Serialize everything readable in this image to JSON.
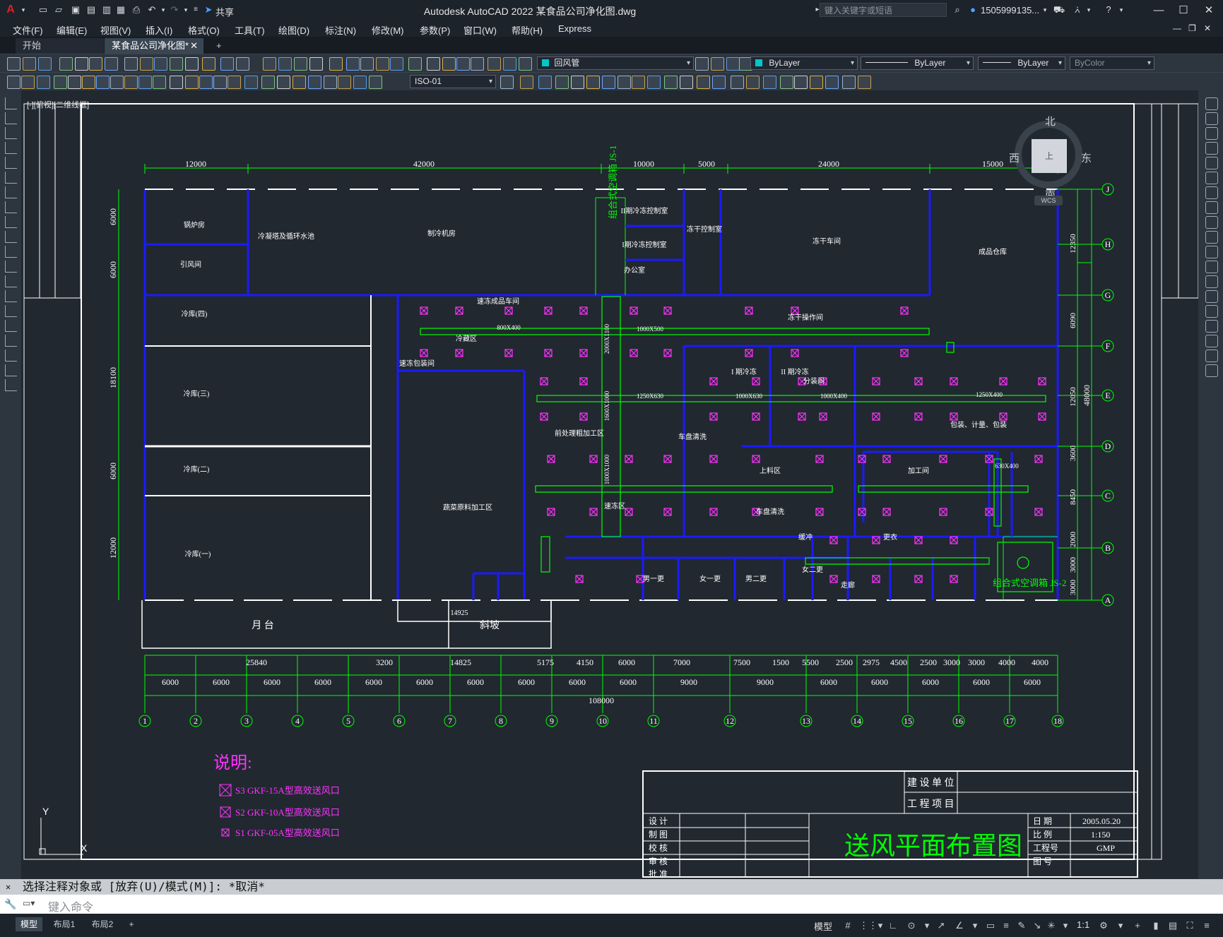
{
  "titlebar": {
    "app_title": "Autodesk AutoCAD 2022    某食品公司净化图.dwg",
    "share_label": "共享",
    "search_placeholder": "键入关键字或短语",
    "user": "1505999135...",
    "minimize": "—",
    "restore": "☐",
    "close": "✕"
  },
  "menu": [
    "文件(F)",
    "编辑(E)",
    "视图(V)",
    "插入(I)",
    "格式(O)",
    "工具(T)",
    "绘图(D)",
    "标注(N)",
    "修改(M)",
    "参数(P)",
    "窗口(W)",
    "帮助(H)",
    "Express"
  ],
  "tabs": {
    "start": "开始",
    "active": "某食品公司净化图*",
    "close": "✕",
    "add": "+"
  },
  "toolbar": {
    "layer_current": "回风管",
    "color": "ByLayer",
    "linetype": "ByLayer",
    "lineweight": "ByLayer",
    "plotstyle": "ByColor",
    "dimstyle": "ISO-01"
  },
  "viewcube": {
    "north": "北",
    "south": "南",
    "east": "东",
    "west": "西",
    "top": "上",
    "wcs": "WCS"
  },
  "drawing": {
    "view_label": "[-][俯视][二维线框]",
    "title_block": {
      "build_unit": "建 设 单 位",
      "project": "工 程 项 目",
      "design": "设 计",
      "draw": "制 图",
      "check": "校 核",
      "review": "审 核",
      "approve": "批 准",
      "date_label": "日 期",
      "date": "2005.05.20",
      "scale_label": "比 例",
      "scale": "1:150",
      "proj_no_label": "工程号",
      "proj_no": "GMP",
      "sheet_label": "图 号",
      "drawing_title": "送风平面布置图"
    },
    "legend": {
      "title": "说明:",
      "items": [
        "S3 GKF-15A型高效送风口",
        "S2 GKF-10A型高效送风口",
        "S1 GKF-05A型高效送风口"
      ]
    },
    "top_dims": [
      "12000",
      "42000",
      "10000",
      "5000",
      "24000",
      "15000"
    ],
    "bottom_dims_row1": [
      "25840",
      "3200",
      "14825",
      "5175",
      "4150",
      "6000",
      "7000",
      "7500",
      "1500",
      "5500",
      "2500",
      "2975",
      "4500",
      "2500",
      "3000",
      "3000",
      "4000",
      "4000"
    ],
    "bottom_dims_row2": [
      "6000",
      "6000",
      "6000",
      "6000",
      "6000",
      "6000",
      "6000",
      "6000",
      "6000",
      "6000",
      "9000",
      "9000",
      "6000",
      "6000",
      "6000",
      "6000",
      "6000"
    ],
    "total_dim": "108000",
    "column_axes": [
      "1",
      "2",
      "3",
      "4",
      "5",
      "6",
      "7",
      "8",
      "9",
      "10",
      "11",
      "12",
      "13",
      "14",
      "15",
      "16",
      "17",
      "18"
    ],
    "row_axes": [
      "J",
      "H",
      "G",
      "F",
      "E",
      "D",
      "C",
      "B",
      "A"
    ],
    "left_dims": [
      "6000",
      "6000",
      "18100",
      "6000",
      "12000"
    ],
    "right_dims": [
      "12350",
      "6090",
      "12050",
      "3600",
      "8450",
      "2000",
      "3000",
      "3000"
    ],
    "right_total": "48000",
    "rooms": [
      "锅炉房",
      "引风间",
      "冷凝塔及循环水池",
      "制冷机房",
      "II期冷冻控制室",
      "I期冷冻控制室",
      "办公室",
      "冻干控制室",
      "冻干车间",
      "成品仓库",
      "冷库(四)",
      "冷库(三)",
      "冷库(二)",
      "冷库(一)",
      "速冻包装间",
      "速冻成品车间",
      "冷藏区",
      "冻干操作间",
      "前处理粗加工区",
      "I 期冷冻",
      "II 期冷冻",
      "分装间",
      "包装、计量、包装",
      "速冻区",
      "上料区",
      "车盘清洗",
      "车盘清洗",
      "蔬菜原料加工区",
      "月 台",
      "14925",
      "斜坡",
      "加工间",
      "组合式空调箱 JS-1",
      "组合式空调箱 JS-2",
      "缓冲",
      "更衣",
      "走廊",
      "男一更",
      "女一更",
      "男二更",
      "女二更"
    ],
    "ducts": [
      "2000X1100",
      "1600X1000",
      "1000X1000",
      "800X400",
      "1000X630",
      "1250X630",
      "1000X500",
      "1000X400",
      "630X400",
      "1250X400"
    ],
    "axis_y": "Y",
    "axis_x": "X"
  },
  "command": {
    "history": "选择注释对象或 [放弃(U)/模式(M)]: *取消*",
    "placeholder": "键入命令"
  },
  "status": {
    "layouts": [
      "模型",
      "布局1",
      "布局2"
    ],
    "add": "+",
    "model": "模型",
    "scale": "1:1"
  },
  "colors": {
    "bg": "#212830",
    "wall": "#1010ff",
    "dim": "#00ff00",
    "text": "#ffffff",
    "outlet": "#ff00ff",
    "duct": "#00ff00"
  }
}
